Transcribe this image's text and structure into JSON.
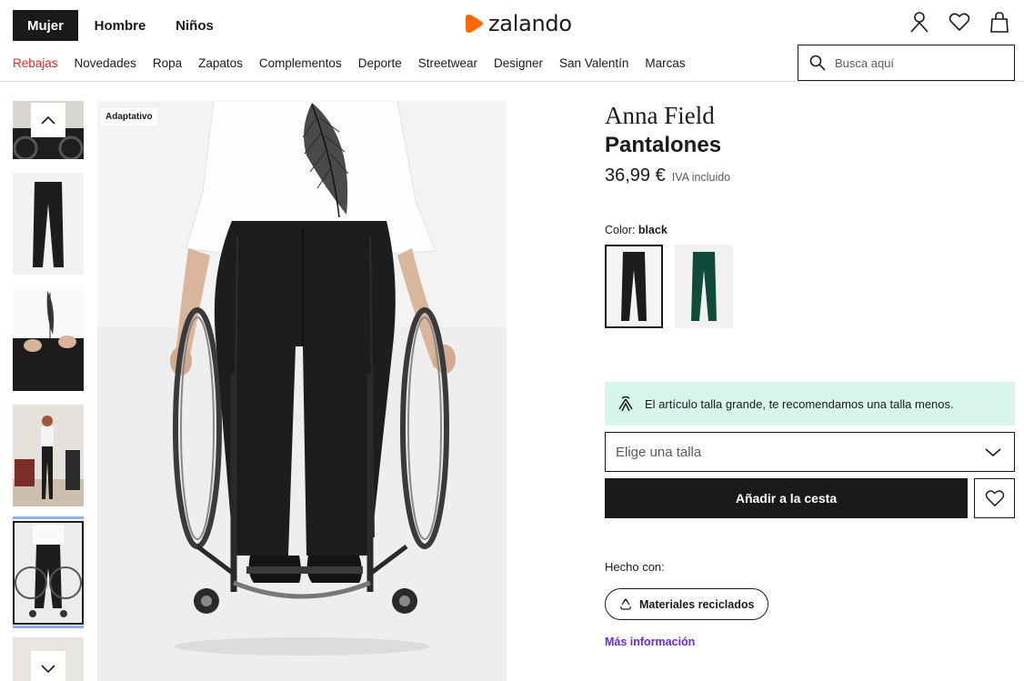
{
  "header": {
    "gender_tabs": [
      {
        "label": "Mujer",
        "active": true
      },
      {
        "label": "Hombre",
        "active": false
      },
      {
        "label": "Niños",
        "active": false
      }
    ],
    "logo_text": "zalando",
    "brand_color": "#ff6900",
    "icons": [
      "user-icon",
      "heart-icon",
      "bag-icon"
    ]
  },
  "nav": {
    "categories": [
      "Rebajas",
      "Novedades",
      "Ropa",
      "Zapatos",
      "Complementos",
      "Deporte",
      "Streetwear",
      "Designer",
      "San Valentín",
      "Marcas"
    ],
    "sale_color": "#d32b2b",
    "search_placeholder": "Busca aquí"
  },
  "gallery": {
    "badge": "Adaptativo",
    "thumbnail_count": 6,
    "selected_index": 4
  },
  "product": {
    "brand": "Anna Field",
    "name": "Pantalones",
    "price": "36,99 €",
    "vat_note": "IVA incluido",
    "color_label": "Color:",
    "color_value": "black",
    "swatches": [
      {
        "name": "black",
        "color": "#1c1c1c",
        "selected": true
      },
      {
        "name": "green",
        "color": "#0f4a3a",
        "selected": false
      }
    ],
    "fit_note": "El artículo talla grande, te recomendamos una talla menos.",
    "fit_note_bg": "#d8f5ea",
    "size_placeholder": "Elige una talla",
    "add_to_cart": "Añadir a la cesta",
    "made_with_label": "Hecho con:",
    "material": "Materiales reciclados",
    "more_info": "Más información",
    "more_info_color": "#6a2bd9"
  }
}
